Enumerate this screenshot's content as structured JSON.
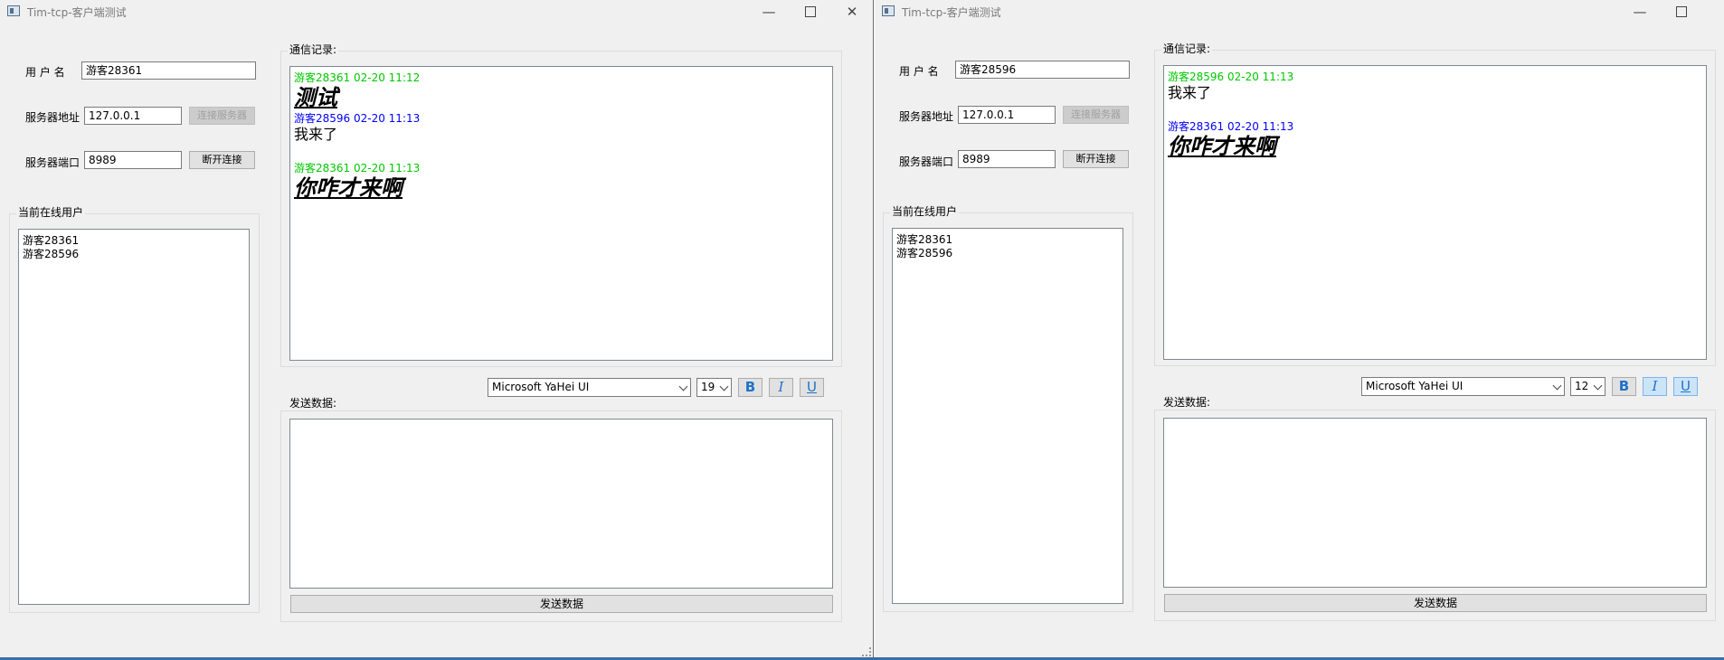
{
  "windows": [
    {
      "title": "Tim-tcp-客户端测试",
      "controls": {
        "minimize": "—",
        "close": "✕"
      },
      "username_label": "用 户 名",
      "username": "游客28361",
      "server_addr_label": "服务器地址",
      "server_addr": "127.0.0.1",
      "connect_button": "连接服务器",
      "server_port_label": "服务器端口",
      "server_port": "8989",
      "disconnect_button": "断开连接",
      "online_group_label": "当前在线用户",
      "online_users": [
        "游客28361",
        "游客28596"
      ],
      "log_label": "通信记录:",
      "messages": [
        {
          "header": "游客28361 02-20 11:12",
          "header_color": "#00c800",
          "body": "测试",
          "style": "big"
        },
        {
          "header": "游客28596 02-20 11:13",
          "header_color": "#0000ff",
          "body": "我来了",
          "style": "normal"
        },
        {
          "header": "游客28361 02-20 11:13",
          "header_color": "#00c800",
          "body": "你咋才来啊",
          "style": "big"
        }
      ],
      "font_name": "Microsoft YaHei UI",
      "font_size": "19",
      "bold_label": "B",
      "italic_label": "I",
      "underline_label": "U",
      "send_label": "发送数据:",
      "send_button": "发送数据"
    },
    {
      "title": "Tim-tcp-客户端测试",
      "controls": {
        "minimize": "—",
        "close": "✕"
      },
      "username_label": "用 户 名",
      "username": "游客28596",
      "server_addr_label": "服务器地址",
      "server_addr": "127.0.0.1",
      "connect_button": "连接服务器",
      "server_port_label": "服务器端口",
      "server_port": "8989",
      "disconnect_button": "断开连接",
      "online_group_label": "当前在线用户",
      "online_users": [
        "游客28361",
        "游客28596"
      ],
      "log_label": "通信记录:",
      "messages": [
        {
          "header": "游客28596 02-20 11:13",
          "header_color": "#00c800",
          "body": "我来了",
          "style": "normal"
        },
        {
          "header": "游客28361 02-20 11:13",
          "header_color": "#0000ff",
          "body": "你咋才来啊",
          "style": "big"
        }
      ],
      "font_name": "Microsoft YaHei UI",
      "font_size": "12",
      "bold_label": "B",
      "italic_label": "I",
      "underline_label": "U",
      "send_label": "发送数据:",
      "send_button": "发送数据"
    }
  ]
}
